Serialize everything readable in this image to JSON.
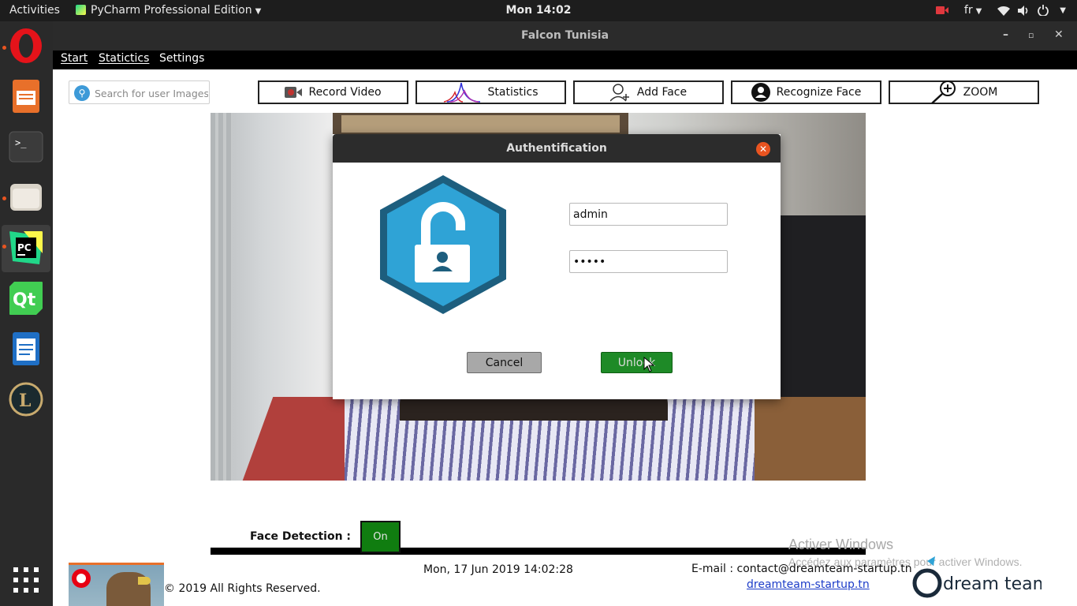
{
  "topbar": {
    "activities": "Activities",
    "app_menu": "PyCharm Professional Edition",
    "clock": "Mon 14:02",
    "keyboard_layout": "fr"
  },
  "dock": {
    "apps": [
      "opera",
      "libreoffice-impress",
      "terminal",
      "files",
      "pycharm",
      "qt-creator",
      "libreoffice-writer",
      "league-of-legends"
    ],
    "show_apps_icon": "grid-icon"
  },
  "window": {
    "title": "Falcon Tunisia",
    "menu": [
      "Start",
      "Statictics",
      "Settings"
    ],
    "search": {
      "placeholder": "Search for user Images"
    },
    "toolbar": {
      "record_video": "Record Video",
      "statistics": "Statistics",
      "add_face": "Add Face",
      "recognize_face": "Recognize Face",
      "zoom": "ZOOM"
    },
    "face_detection": {
      "label": "Face Detection :",
      "state": "On",
      "state_color": "#107d10"
    },
    "watermark": {
      "title": "Activer Windows",
      "subtitle": "Accédez aux paramètres pour activer Windows."
    },
    "footer": {
      "copyright": "© 2019 All Rights Reserved.",
      "datetime": "Mon, 17 Jun 2019 14:02:28",
      "email": "E-mail : contact@dreamteam-startup.tn",
      "website": "dreamteam-startup.tn",
      "logo_text": "dream team"
    }
  },
  "dialog": {
    "title": "Authentification",
    "username": "admin",
    "password": "admin",
    "cancel_label": "Cancel",
    "unlock_label": "Unlock",
    "accent": "#2fa3d6",
    "border": "#1d5e7e"
  }
}
